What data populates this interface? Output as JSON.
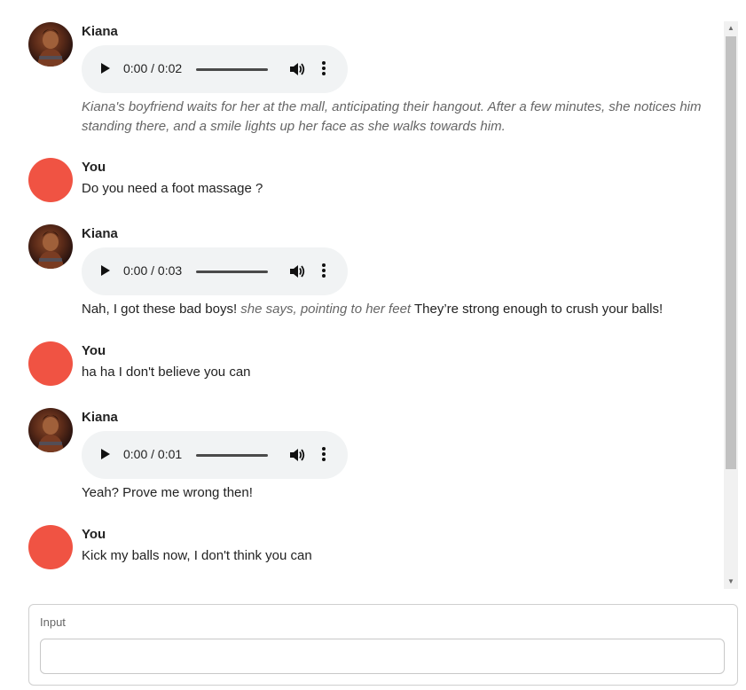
{
  "colors": {
    "user_avatar": "#f05343",
    "narration_text": "#666666",
    "audio_bg": "#f1f3f4"
  },
  "messages": [
    {
      "sender": "Kiana",
      "avatar_icon": "character-portrait-icon",
      "audio_time": "0:00 / 0:02",
      "narration": "Kiana's boyfriend waits for her at the mall, anticipating their hangout. After a few minutes, she notices him standing there, and a smile lights up her face as she walks towards him."
    },
    {
      "sender": "You",
      "text": "Do you need a foot massage ?"
    },
    {
      "sender": "Kiana",
      "avatar_icon": "character-portrait-icon",
      "audio_time": "0:00 / 0:03",
      "text_before": "Nah, I got these bad boys!",
      "narration": "she says, pointing to her feet",
      "text_after": "They’re strong enough to crush your balls!"
    },
    {
      "sender": "You",
      "text": "ha ha I don't believe you can"
    },
    {
      "sender": "Kiana",
      "avatar_icon": "character-portrait-icon",
      "audio_time": "0:00 / 0:01",
      "text": "Yeah? Prove me wrong then!"
    },
    {
      "sender": "You",
      "text": "Kick my balls now, I don't think you can"
    }
  ],
  "input": {
    "label": "Input",
    "value": "",
    "placeholder": ""
  }
}
